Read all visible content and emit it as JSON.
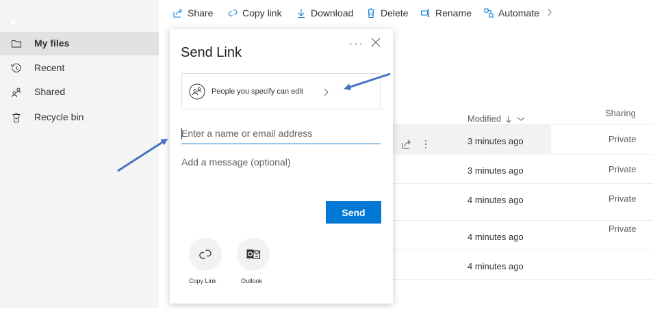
{
  "toolbar": {
    "share": "Share",
    "copy_link": "Copy link",
    "download": "Download",
    "delete": "Delete",
    "rename": "Rename",
    "automate": "Automate"
  },
  "nav": {
    "items": [
      {
        "label": "My files",
        "icon": "folder-icon",
        "active": true
      },
      {
        "label": "Recent",
        "icon": "history-icon",
        "active": false
      },
      {
        "label": "Shared",
        "icon": "people-icon",
        "active": false
      },
      {
        "label": "Recycle bin",
        "icon": "recycle-bin-icon",
        "active": false
      }
    ]
  },
  "list": {
    "columns": {
      "modified": "Modified",
      "sharing": "Sharing"
    },
    "rows": [
      {
        "modified": "3 minutes ago",
        "sharing": "Private"
      },
      {
        "modified": "3 minutes ago",
        "sharing": "Private"
      },
      {
        "modified": "4 minutes ago",
        "sharing": "Private"
      },
      {
        "modified": "4 minutes ago",
        "sharing": "Private"
      },
      {
        "modified": "4 minutes ago",
        "sharing": ""
      }
    ]
  },
  "dialog": {
    "title": "Send Link",
    "more": "···",
    "permission_label": "People you specify can edit",
    "email_placeholder": "Enter a name or email address",
    "message_placeholder": "Add a message (optional)",
    "send_label": "Send",
    "options": [
      {
        "label": "Copy Link",
        "icon": "link-icon"
      },
      {
        "label": "Outlook",
        "icon": "outlook-icon"
      }
    ]
  },
  "colors": {
    "accent": "#0078d4",
    "arrow": "#4472c4",
    "nav_bg": "#f4f4f4",
    "nav_active": "#e1e1e1"
  }
}
